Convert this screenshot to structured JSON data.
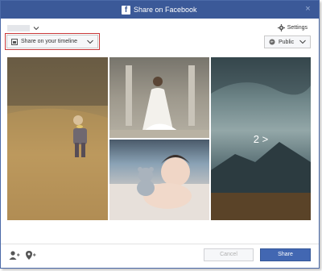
{
  "window": {
    "title": "Share on Facebook",
    "brand_color": "#3b5998",
    "close_icon": "close-icon"
  },
  "account": {
    "chevron_icon": "chevron-down-icon"
  },
  "settings": {
    "label": "Settings",
    "icon": "gear-icon"
  },
  "destination": {
    "label": "Share on your timeline",
    "icon": "timeline-icon",
    "highlight_color": "#c8383a"
  },
  "privacy": {
    "label": "Public",
    "icon": "globe-icon"
  },
  "photos": {
    "items": [
      {
        "subject": "child in field",
        "icon": "photo"
      },
      {
        "subject": "bride in gown",
        "icon": "photo"
      },
      {
        "subject": "baby with teddy bear",
        "icon": "photo"
      },
      {
        "subject": "mountain landscape",
        "icon": "photo"
      }
    ],
    "more_label": "2 >"
  },
  "footer": {
    "tag_icon": "add-person-icon",
    "location_icon": "location-pin-icon",
    "cancel_label": "Cancel",
    "share_label": "Share",
    "share_color": "#4267b2"
  }
}
